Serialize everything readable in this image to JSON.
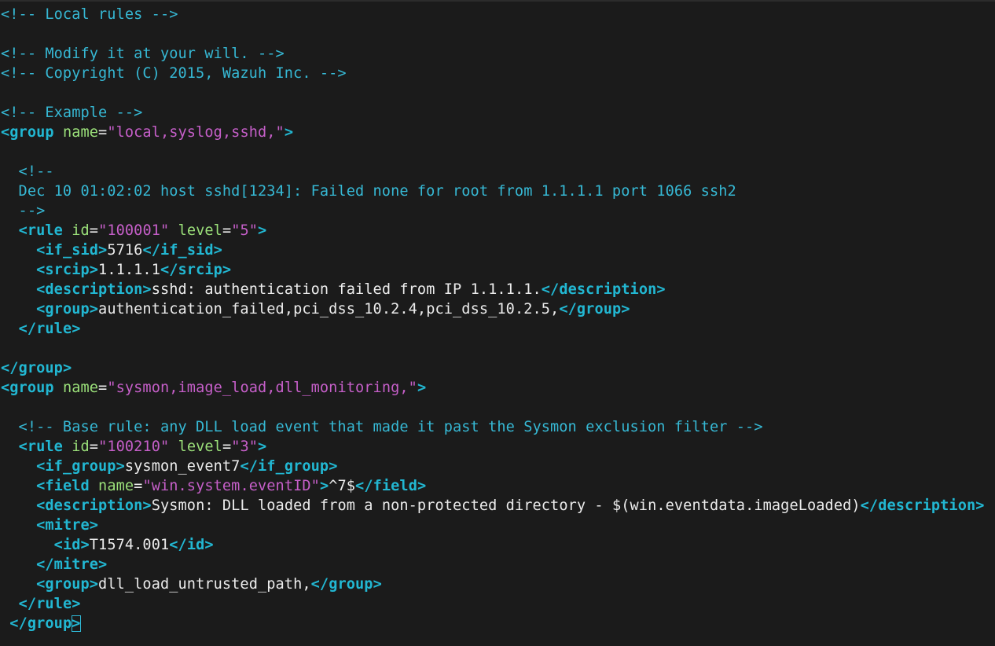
{
  "editor": {
    "lines": [
      [
        {
          "t": "comment",
          "v": "<!-- Local rules -->"
        }
      ],
      [],
      [
        {
          "t": "comment",
          "v": "<!-- Modify it at your will. -->"
        }
      ],
      [
        {
          "t": "comment",
          "v": "<!-- Copyright (C) 2015, Wazuh Inc. -->"
        }
      ],
      [],
      [
        {
          "t": "comment",
          "v": "<!-- Example -->"
        }
      ],
      [
        {
          "t": "bracket",
          "v": "<"
        },
        {
          "t": "tag",
          "v": "group"
        },
        {
          "t": "text",
          "v": " "
        },
        {
          "t": "attr",
          "v": "name"
        },
        {
          "t": "eq",
          "v": "="
        },
        {
          "t": "value",
          "v": "\"local,syslog,sshd,\""
        },
        {
          "t": "bracket",
          "v": ">"
        }
      ],
      [],
      [
        {
          "t": "comment",
          "v": "  <!--"
        }
      ],
      [
        {
          "t": "comment",
          "v": "  Dec 10 01:02:02 host sshd[1234]: Failed none for root from 1.1.1.1 port 1066 ssh2"
        }
      ],
      [
        {
          "t": "comment",
          "v": "  -->"
        }
      ],
      [
        {
          "t": "text",
          "v": "  "
        },
        {
          "t": "bracket",
          "v": "<"
        },
        {
          "t": "tag",
          "v": "rule"
        },
        {
          "t": "text",
          "v": " "
        },
        {
          "t": "attr",
          "v": "id"
        },
        {
          "t": "eq",
          "v": "="
        },
        {
          "t": "value",
          "v": "\"100001\""
        },
        {
          "t": "text",
          "v": " "
        },
        {
          "t": "attr",
          "v": "level"
        },
        {
          "t": "eq",
          "v": "="
        },
        {
          "t": "value",
          "v": "\"5\""
        },
        {
          "t": "bracket",
          "v": ">"
        }
      ],
      [
        {
          "t": "text",
          "v": "    "
        },
        {
          "t": "bracket",
          "v": "<"
        },
        {
          "t": "tag",
          "v": "if_sid"
        },
        {
          "t": "bracket",
          "v": ">"
        },
        {
          "t": "text",
          "v": "5716"
        },
        {
          "t": "bracket",
          "v": "</"
        },
        {
          "t": "tag",
          "v": "if_sid"
        },
        {
          "t": "bracket",
          "v": ">"
        }
      ],
      [
        {
          "t": "text",
          "v": "    "
        },
        {
          "t": "bracket",
          "v": "<"
        },
        {
          "t": "tag",
          "v": "srcip"
        },
        {
          "t": "bracket",
          "v": ">"
        },
        {
          "t": "text",
          "v": "1.1.1.1"
        },
        {
          "t": "bracket",
          "v": "</"
        },
        {
          "t": "tag",
          "v": "srcip"
        },
        {
          "t": "bracket",
          "v": ">"
        }
      ],
      [
        {
          "t": "text",
          "v": "    "
        },
        {
          "t": "bracket",
          "v": "<"
        },
        {
          "t": "tag",
          "v": "description"
        },
        {
          "t": "bracket",
          "v": ">"
        },
        {
          "t": "text",
          "v": "sshd: authentication failed from IP 1.1.1.1."
        },
        {
          "t": "bracket",
          "v": "</"
        },
        {
          "t": "tag",
          "v": "description"
        },
        {
          "t": "bracket",
          "v": ">"
        }
      ],
      [
        {
          "t": "text",
          "v": "    "
        },
        {
          "t": "bracket",
          "v": "<"
        },
        {
          "t": "tag",
          "v": "group"
        },
        {
          "t": "bracket",
          "v": ">"
        },
        {
          "t": "text",
          "v": "authentication_failed,pci_dss_10.2.4,pci_dss_10.2.5,"
        },
        {
          "t": "bracket",
          "v": "</"
        },
        {
          "t": "tag",
          "v": "group"
        },
        {
          "t": "bracket",
          "v": ">"
        }
      ],
      [
        {
          "t": "text",
          "v": "  "
        },
        {
          "t": "bracket",
          "v": "</"
        },
        {
          "t": "tag",
          "v": "rule"
        },
        {
          "t": "bracket",
          "v": ">"
        }
      ],
      [],
      [
        {
          "t": "bracket",
          "v": "</"
        },
        {
          "t": "tag",
          "v": "group"
        },
        {
          "t": "bracket",
          "v": ">"
        }
      ],
      [
        {
          "t": "bracket",
          "v": "<"
        },
        {
          "t": "tag",
          "v": "group"
        },
        {
          "t": "text",
          "v": " "
        },
        {
          "t": "attr",
          "v": "name"
        },
        {
          "t": "eq",
          "v": "="
        },
        {
          "t": "value",
          "v": "\"sysmon,image_load,dll_monitoring,\""
        },
        {
          "t": "bracket",
          "v": ">"
        }
      ],
      [],
      [
        {
          "t": "comment",
          "v": "  <!-- Base rule: any DLL load event that made it past the Sysmon exclusion filter -->"
        }
      ],
      [
        {
          "t": "text",
          "v": "  "
        },
        {
          "t": "bracket",
          "v": "<"
        },
        {
          "t": "tag",
          "v": "rule"
        },
        {
          "t": "text",
          "v": " "
        },
        {
          "t": "attr",
          "v": "id"
        },
        {
          "t": "eq",
          "v": "="
        },
        {
          "t": "value",
          "v": "\"100210\""
        },
        {
          "t": "text",
          "v": " "
        },
        {
          "t": "attr",
          "v": "level"
        },
        {
          "t": "eq",
          "v": "="
        },
        {
          "t": "value",
          "v": "\"3\""
        },
        {
          "t": "bracket",
          "v": ">"
        }
      ],
      [
        {
          "t": "text",
          "v": "    "
        },
        {
          "t": "bracket",
          "v": "<"
        },
        {
          "t": "tag",
          "v": "if_group"
        },
        {
          "t": "bracket",
          "v": ">"
        },
        {
          "t": "text",
          "v": "sysmon_event7"
        },
        {
          "t": "bracket",
          "v": "</"
        },
        {
          "t": "tag",
          "v": "if_group"
        },
        {
          "t": "bracket",
          "v": ">"
        }
      ],
      [
        {
          "t": "text",
          "v": "    "
        },
        {
          "t": "bracket",
          "v": "<"
        },
        {
          "t": "tag",
          "v": "field"
        },
        {
          "t": "text",
          "v": " "
        },
        {
          "t": "attr",
          "v": "name"
        },
        {
          "t": "eq",
          "v": "="
        },
        {
          "t": "value",
          "v": "\"win.system.eventID\""
        },
        {
          "t": "bracket",
          "v": ">"
        },
        {
          "t": "text",
          "v": "^7$"
        },
        {
          "t": "bracket",
          "v": "</"
        },
        {
          "t": "tag",
          "v": "field"
        },
        {
          "t": "bracket",
          "v": ">"
        }
      ],
      [
        {
          "t": "text",
          "v": "    "
        },
        {
          "t": "bracket",
          "v": "<"
        },
        {
          "t": "tag",
          "v": "description"
        },
        {
          "t": "bracket",
          "v": ">"
        },
        {
          "t": "text",
          "v": "Sysmon: DLL loaded from a non-protected directory - $(win.eventdata.imageLoaded)"
        },
        {
          "t": "bracket",
          "v": "</"
        },
        {
          "t": "tag",
          "v": "description"
        },
        {
          "t": "bracket",
          "v": ">"
        }
      ],
      [
        {
          "t": "text",
          "v": "    "
        },
        {
          "t": "bracket",
          "v": "<"
        },
        {
          "t": "tag",
          "v": "mitre"
        },
        {
          "t": "bracket",
          "v": ">"
        }
      ],
      [
        {
          "t": "text",
          "v": "      "
        },
        {
          "t": "bracket",
          "v": "<"
        },
        {
          "t": "tag",
          "v": "id"
        },
        {
          "t": "bracket",
          "v": ">"
        },
        {
          "t": "text",
          "v": "T1574.001"
        },
        {
          "t": "bracket",
          "v": "</"
        },
        {
          "t": "tag",
          "v": "id"
        },
        {
          "t": "bracket",
          "v": ">"
        }
      ],
      [
        {
          "t": "text",
          "v": "    "
        },
        {
          "t": "bracket",
          "v": "</"
        },
        {
          "t": "tag",
          "v": "mitre"
        },
        {
          "t": "bracket",
          "v": ">"
        }
      ],
      [
        {
          "t": "text",
          "v": "    "
        },
        {
          "t": "bracket",
          "v": "<"
        },
        {
          "t": "tag",
          "v": "group"
        },
        {
          "t": "bracket",
          "v": ">"
        },
        {
          "t": "text",
          "v": "dll_load_untrusted_path,"
        },
        {
          "t": "bracket",
          "v": "</"
        },
        {
          "t": "tag",
          "v": "group"
        },
        {
          "t": "bracket",
          "v": ">"
        }
      ],
      [
        {
          "t": "text",
          "v": "  "
        },
        {
          "t": "bracket",
          "v": "</"
        },
        {
          "t": "tag",
          "v": "rule"
        },
        {
          "t": "bracket",
          "v": ">"
        }
      ],
      [
        {
          "t": "text",
          "v": " "
        },
        {
          "t": "bracket",
          "v": "</"
        },
        {
          "t": "tag",
          "v": "group"
        },
        {
          "t": "cursor",
          "v": ">"
        }
      ]
    ]
  }
}
